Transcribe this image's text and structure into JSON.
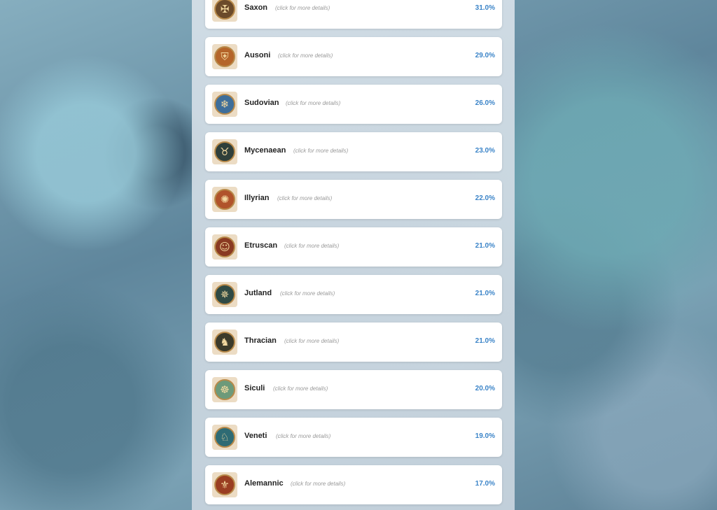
{
  "hint_text": "(click for more details)",
  "results": [
    {
      "name": "Saxon",
      "percent": "31.0%",
      "icon": "helmet-icon",
      "medal_color": "#6b4a2a",
      "glyph": "✠"
    },
    {
      "name": "Ausoni",
      "percent": "29.0%",
      "icon": "shield-icon",
      "medal_color": "#b5652a",
      "glyph": "⛨"
    },
    {
      "name": "Sudovian",
      "percent": "26.0%",
      "icon": "snowflake-icon",
      "medal_color": "#3e6e9a",
      "glyph": "❄"
    },
    {
      "name": "Mycenaean",
      "percent": "23.0%",
      "icon": "bull-icon",
      "medal_color": "#2f3f3a",
      "glyph": "♉"
    },
    {
      "name": "Illyrian",
      "percent": "22.0%",
      "icon": "sun-icon",
      "medal_color": "#b0532b",
      "glyph": "✺"
    },
    {
      "name": "Etruscan",
      "percent": "21.0%",
      "icon": "face-icon",
      "medal_color": "#8a3a22",
      "glyph": "☺"
    },
    {
      "name": "Jutland",
      "percent": "21.0%",
      "icon": "compass-icon",
      "medal_color": "#2f4a44",
      "glyph": "✵"
    },
    {
      "name": "Thracian",
      "percent": "21.0%",
      "icon": "horseman-icon",
      "medal_color": "#3b3a2a",
      "glyph": "♞"
    },
    {
      "name": "Siculi",
      "percent": "20.0%",
      "icon": "triskelion-icon",
      "medal_color": "#6d9a7a",
      "glyph": "☸"
    },
    {
      "name": "Veneti",
      "percent": "19.0%",
      "icon": "horse-icon",
      "medal_color": "#2e6b74",
      "glyph": "♘"
    },
    {
      "name": "Alemannic",
      "percent": "17.0%",
      "icon": "eagle-icon",
      "medal_color": "#9a3e22",
      "glyph": "⚜"
    }
  ]
}
